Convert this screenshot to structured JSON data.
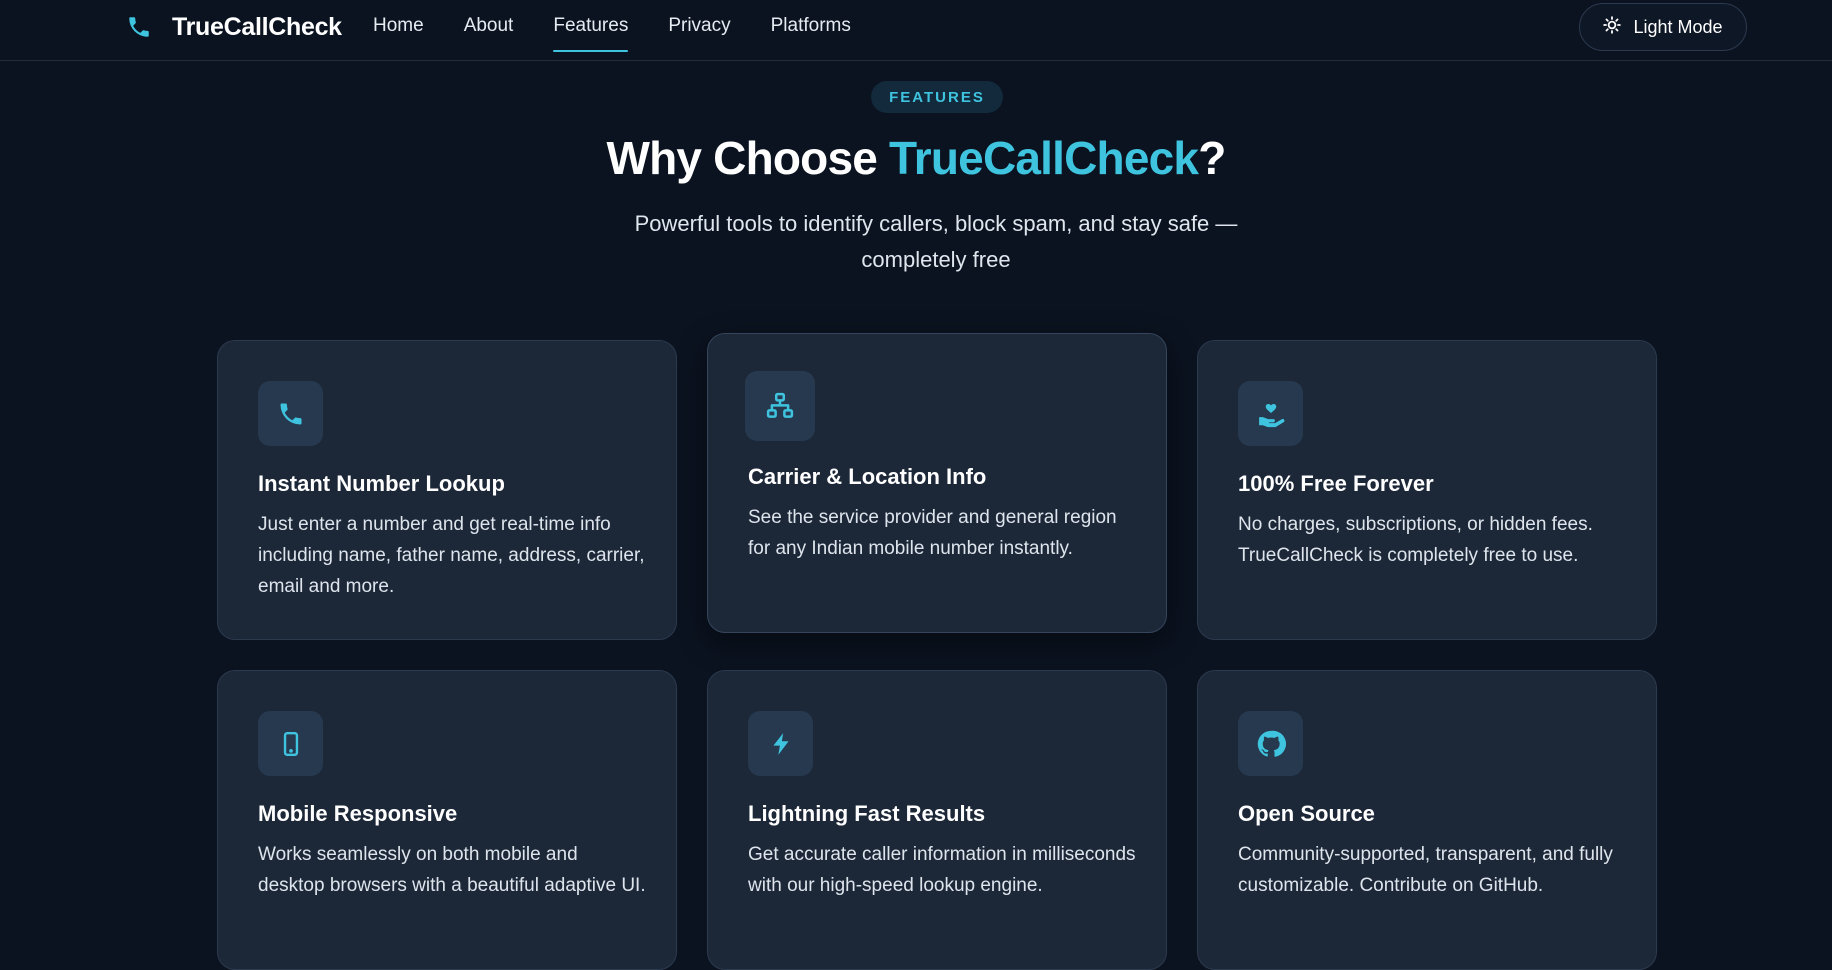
{
  "nav": {
    "brand": "TrueCallCheck",
    "links": [
      {
        "label": "Home"
      },
      {
        "label": "About"
      },
      {
        "label": "Features"
      },
      {
        "label": "Privacy"
      },
      {
        "label": "Platforms"
      }
    ],
    "active_link": "Features",
    "mode_button": "Light Mode"
  },
  "hero": {
    "badge": "FEATURES",
    "title_prefix": "Why Choose ",
    "title_accent": "TrueCallCheck",
    "title_suffix": "?",
    "subtitle": "Powerful tools to identify callers, block spam, and stay safe — completely free"
  },
  "features": [
    {
      "icon": "phone-icon",
      "title": "Instant Number Lookup",
      "desc": "Just enter a number and get real-time info including name, father name, address, carrier, email and more."
    },
    {
      "icon": "network-icon",
      "title": "Carrier & Location Info",
      "desc": "See the service provider and general region for any Indian mobile number instantly."
    },
    {
      "icon": "hand-heart-icon",
      "title": "100% Free Forever",
      "desc": "No charges, subscriptions, or hidden fees. TrueCallCheck is completely free to use."
    },
    {
      "icon": "mobile-icon",
      "title": "Mobile Responsive",
      "desc": "Works seamlessly on both mobile and desktop browsers with a beautiful adaptive UI."
    },
    {
      "icon": "bolt-icon",
      "title": "Lightning Fast Results",
      "desc": "Get accurate caller information in milliseconds with our high-speed lookup engine."
    },
    {
      "icon": "github-icon",
      "title": "Open Source",
      "desc": "Community-supported, transparent, and fully customizable. Contribute on GitHub."
    }
  ],
  "colors": {
    "background": "#0b1320",
    "card": "#1c2738",
    "accent": "#3fc4e0"
  }
}
